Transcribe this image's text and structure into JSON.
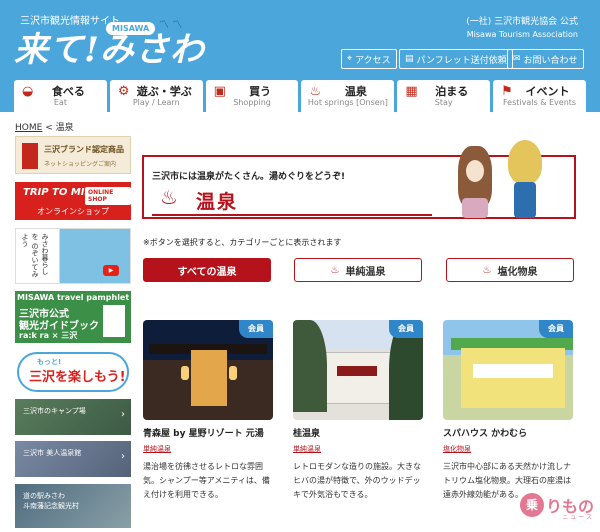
{
  "header": {
    "site_tag": "三沢市観光情報サイト",
    "logo": "来て!みさわ",
    "logo_badge": "MISAWA",
    "org": "(一社) 三沢市観光協会 公式",
    "org_en": "Misawa Tourism Association",
    "buttons": [
      {
        "icon": "map-pin-icon",
        "label": "アクセス"
      },
      {
        "icon": "document-icon",
        "label": "パンフレット送付依頼"
      },
      {
        "icon": "mail-icon",
        "label": "お問い合わせ"
      }
    ]
  },
  "nav": [
    {
      "icon": "bowl-icon",
      "label": "食べる",
      "sub": "Eat"
    },
    {
      "icon": "bicycle-icon",
      "label": "遊ぶ・学ぶ",
      "sub": "Play / Learn"
    },
    {
      "icon": "shopping-bag-icon",
      "label": "買う",
      "sub": "Shopping"
    },
    {
      "icon": "hot-spring-icon",
      "label": "温泉",
      "sub": "Hot springs [Onsen]"
    },
    {
      "icon": "hotel-icon",
      "label": "泊まる",
      "sub": "Stay"
    },
    {
      "icon": "flag-icon",
      "label": "イベント",
      "sub": "Festivals & Events"
    }
  ],
  "breadcrumb": {
    "home": "HOME",
    "sep": "<",
    "current": "温泉"
  },
  "sidebar": {
    "brand": {
      "title": "三沢ブランド認定商品",
      "sub": "ネットショッピングご案内"
    },
    "shop": {
      "top": "TRIP TO MISAWA",
      "badge": "ONLINE SHOP",
      "label": "オンラインショップ"
    },
    "video": {
      "vertical": "みさわ暮らしを のぞいてみよう"
    },
    "pamphlet": {
      "header": "MISAWA travel pamphlet",
      "line1": "三沢市公式",
      "line2": "観光ガイドブック",
      "brand": "ra:k ra × 三沢"
    },
    "fun": {
      "small": "もっと!",
      "big": "三沢を楽しもう!"
    },
    "links": [
      {
        "label": "三沢市のキャンプ場"
      },
      {
        "label": "三沢市 美人温泉館"
      },
      {
        "label": "道の駅みさわ\n斗南藩記念観光村"
      }
    ]
  },
  "banner": {
    "lead": "三沢市には温泉がたくさん。湯めぐりをどうぞ!",
    "title": "温泉"
  },
  "note": "※ボタンを選択すると、カテゴリーごとに表示されます",
  "filters": [
    {
      "label": "すべての温泉",
      "active": true
    },
    {
      "label": "単純温泉",
      "active": false
    },
    {
      "label": "塩化物泉",
      "active": false
    }
  ],
  "cards": [
    {
      "badge": "会員",
      "name": "青森屋 by 星野リゾート 元湯",
      "category": "単純温泉",
      "desc": "湯治場を彷彿させるレトロな雰囲気。シャンプー等アメニティは、備え付けを利用できる。"
    },
    {
      "badge": "会員",
      "name": "桂温泉",
      "category": "単純温泉",
      "desc": "レトロモダンな造りの施設。大きなヒバの湯が特徴で、外のウッドデッキで外気浴もできる。"
    },
    {
      "badge": "会員",
      "name": "スパハウス かわむら",
      "category": "塩化物泉",
      "desc": "三沢市中心部にある天然かけ流しナトリウム塩化物泉。大理石の座湯は遠赤外線効能がある。"
    }
  ],
  "watermark": {
    "char": "乗",
    "text": "りもの",
    "sub": "ニュース"
  }
}
